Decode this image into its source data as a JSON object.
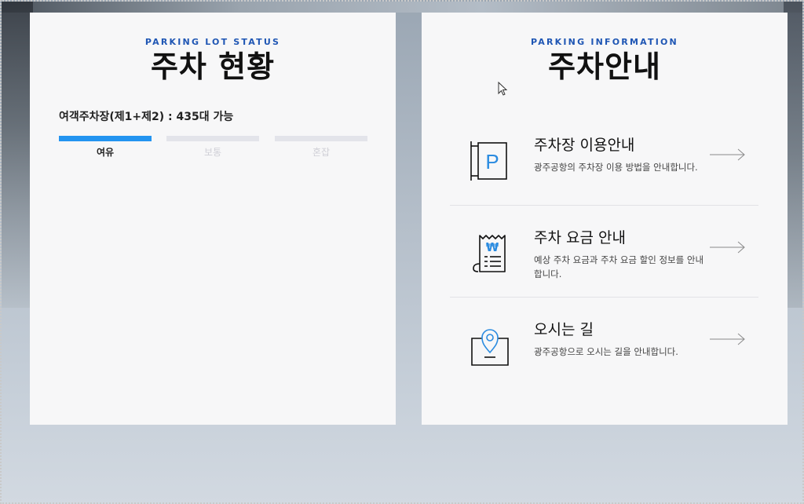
{
  "parking_status": {
    "eyebrow": "PARKING LOT STATUS",
    "title": "주차 현황",
    "lot_label": "여객주차장(제1+제2) : 435대 가능",
    "levels": [
      {
        "label": "여유",
        "active": true
      },
      {
        "label": "보통",
        "active": false
      },
      {
        "label": "혼잡",
        "active": false
      }
    ]
  },
  "parking_info": {
    "eyebrow": "PARKING INFORMATION",
    "title": "주차안내",
    "items": [
      {
        "title": "주차장 이용안내",
        "desc": "광주공항의 주차장 이용 방법을 안내합니다.",
        "icon": "parking-sign-icon"
      },
      {
        "title": "주차 요금 안내",
        "desc": "예상 주차 요금과 주차 요금 할인 정보를 안내합니다.",
        "icon": "won-receipt-icon"
      },
      {
        "title": "오시는 길",
        "desc": "광주공항으로 오시는 길을 안내합니다.",
        "icon": "location-map-icon"
      }
    ]
  },
  "colors": {
    "accent": "#2394f0",
    "eyebrow": "#1f56b4",
    "icon_blue": "#2a8be0"
  }
}
